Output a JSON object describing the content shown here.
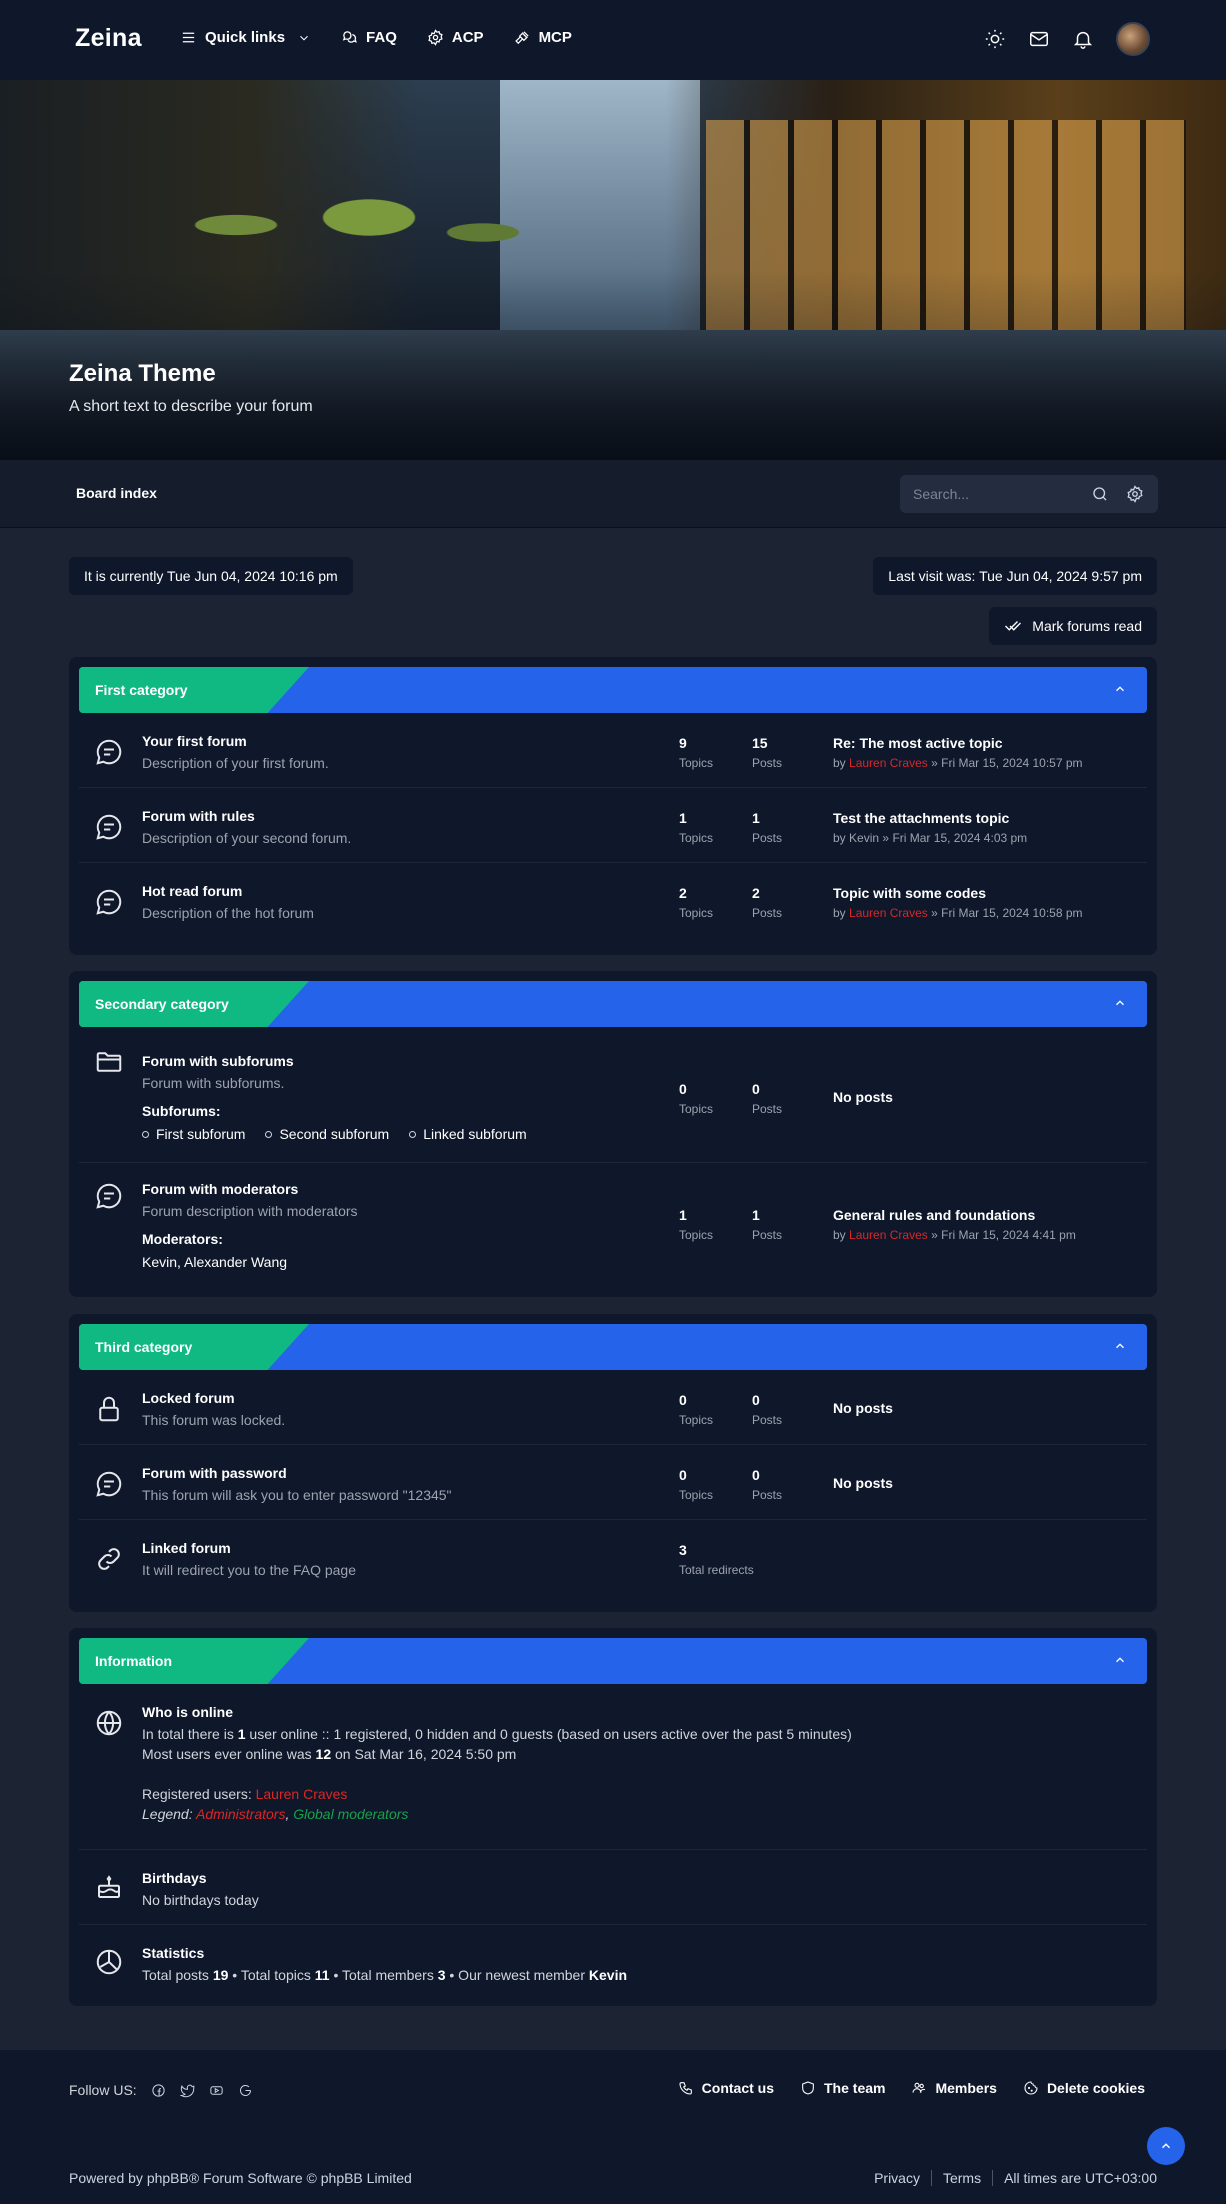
{
  "header": {
    "logo": "Zeina",
    "nav": {
      "quick_links": "Quick links",
      "faq": "FAQ",
      "acp": "ACP",
      "mcp": "MCP"
    }
  },
  "hero": {
    "title": "Zeina Theme",
    "subtitle": "A short text to describe your forum"
  },
  "breadcrumb": {
    "board_index": "Board index",
    "search_placeholder": "Search..."
  },
  "info_bar": {
    "current_time": "It is currently Tue Jun 04, 2024 10:16 pm",
    "last_visit": "Last visit was: Tue Jun 04, 2024 9:57 pm",
    "mark_read": "Mark forums read"
  },
  "labels": {
    "topics": "Topics",
    "posts": "Posts",
    "by": "by",
    "sep": "»",
    "subforums": "Subforums:",
    "moderators": "Moderators:",
    "no_posts": "No posts",
    "total_redirects": "Total redirects"
  },
  "categories": [
    {
      "title": "First category",
      "forums": [
        {
          "name": "Your first forum",
          "desc": "Description of your first forum.",
          "topics": "9",
          "posts": "15",
          "last_title": "Re: The most active topic",
          "last_user": "Lauren Craves",
          "last_user_color": "#dc2626",
          "last_time": "Fri Mar 15, 2024 10:57 pm"
        },
        {
          "name": "Forum with rules",
          "desc": "Description of your second forum.",
          "topics": "1",
          "posts": "1",
          "last_title": "Test the attachments topic",
          "last_user": "Kevin",
          "last_user_color": "#9ca3af",
          "last_time": "Fri Mar 15, 2024 4:03 pm"
        },
        {
          "name": "Hot read forum",
          "desc": "Description of the hot forum",
          "topics": "2",
          "posts": "2",
          "last_title": "Topic with some codes",
          "last_user": "Lauren Craves",
          "last_user_color": "#dc2626",
          "last_time": "Fri Mar 15, 2024 10:58 pm"
        }
      ]
    },
    {
      "title": "Secondary category",
      "forums": [
        {
          "name": "Forum with subforums",
          "desc": "Forum with subforums.",
          "topics": "0",
          "posts": "0",
          "subforums": [
            "First subforum",
            "Second subforum",
            "Linked subforum"
          ]
        },
        {
          "name": "Forum with moderators",
          "desc": "Forum description with moderators",
          "topics": "1",
          "posts": "1",
          "moderators": "Kevin,  Alexander Wang",
          "last_title": "General rules and foundations",
          "last_user": "Lauren Craves",
          "last_user_color": "#dc2626",
          "last_time": "Fri Mar 15, 2024 4:41 pm"
        }
      ]
    },
    {
      "title": "Third category",
      "forums": [
        {
          "name": "Locked forum",
          "desc": "This forum was locked.",
          "topics": "0",
          "posts": "0"
        },
        {
          "name": "Forum with password",
          "desc": "This forum will ask you to enter password \"12345\"",
          "topics": "0",
          "posts": "0"
        },
        {
          "name": "Linked forum",
          "desc": "It will redirect you to the FAQ page",
          "redirects": "3"
        }
      ]
    }
  ],
  "information": {
    "title": "Information",
    "online": {
      "title": "Who is online",
      "line1_pre": "In total there is ",
      "line1_num": "1",
      "line1_post": " user online :: 1 registered, 0 hidden and 0 guests (based on users active over the past 5 minutes)",
      "line2_pre": "Most users ever online was ",
      "line2_num": "12",
      "line2_post": " on Sat Mar 16, 2024 5:50 pm",
      "registered_label": "Registered users: ",
      "registered_user": "Lauren Craves",
      "legend_label": "Legend: ",
      "legend_admin": "Administrators",
      "legend_sep": ", ",
      "legend_gmod": "Global moderators"
    },
    "birthdays": {
      "title": "Birthdays",
      "text": "No birthdays today"
    },
    "statistics": {
      "title": "Statistics",
      "posts_label": "Total posts ",
      "posts": "19",
      "topics_label": " • Total topics ",
      "topics": "11",
      "members_label": " • Total members ",
      "members": "3",
      "newest_label": " • Our newest member ",
      "newest": "Kevin"
    }
  },
  "footer": {
    "follow": "Follow US:",
    "contact": "Contact us",
    "team": "The team",
    "members": "Members",
    "cookies": "Delete cookies",
    "powered": "Powered by phpBB® Forum Software © phpBB Limited",
    "privacy": "Privacy",
    "terms": "Terms",
    "timezone": "All times are UTC+03:00"
  },
  "colors": {
    "accent": "#2563eb",
    "category_green": "#10b981",
    "admin_red": "#dc2626",
    "gmod_green": "#16a34a"
  }
}
